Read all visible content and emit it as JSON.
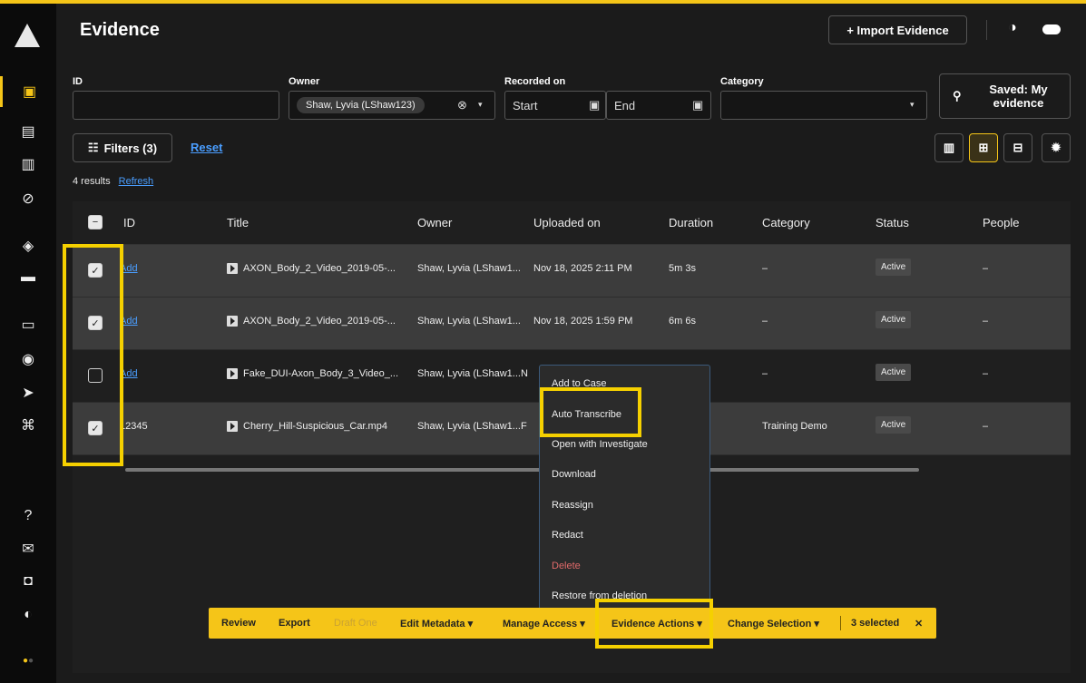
{
  "header": {
    "title": "Evidence",
    "import_label": "+ Import Evidence"
  },
  "filters": {
    "id_label": "ID",
    "owner_label": "Owner",
    "owner_chip": "Shaw, Lyvia (LShaw123)",
    "recorded_label": "Recorded on",
    "start_placeholder": "Start",
    "end_placeholder": "End",
    "category_label": "Category",
    "saved_label": "Saved: My evidence",
    "filters_btn": "Filters (3)",
    "reset": "Reset",
    "results": "4 results",
    "refresh": "Refresh"
  },
  "table": {
    "headers": [
      "ID",
      "Title",
      "Owner",
      "Uploaded on",
      "Duration",
      "Category",
      "Status",
      "People"
    ],
    "rows": [
      {
        "id": "Add",
        "title": "AXON_Body_2_Video_2019-05-...",
        "owner": "Shaw, Lyvia (LShaw1...",
        "uploaded": "Nov 18, 2025 2:11 PM",
        "duration": "5m 3s",
        "category": "–",
        "status": "Active",
        "people": "–",
        "checked": true
      },
      {
        "id": "Add",
        "title": "AXON_Body_2_Video_2019-05-...",
        "owner": "Shaw, Lyvia (LShaw1...",
        "uploaded": "Nov 18, 2025 1:59 PM",
        "duration": "6m 6s",
        "category": "–",
        "status": "Active",
        "people": "–",
        "checked": true
      },
      {
        "id": "Add",
        "title": "Fake_DUI-Axon_Body_3_Video_...",
        "owner": "Shaw, Lyvia (LShaw1...",
        "uploaded": "N",
        "duration": "",
        "category": "–",
        "status": "Active",
        "people": "–",
        "checked": false
      },
      {
        "id": "12345",
        "title": "Cherry_Hill-Suspicious_Car.mp4",
        "owner": "Shaw, Lyvia (LShaw1...",
        "uploaded": "F",
        "duration": "",
        "category": "Training Demo",
        "status": "Active",
        "people": "–",
        "checked": true
      }
    ]
  },
  "menu": {
    "items": [
      "Add to Case",
      "Auto Transcribe",
      "Open with Investigate",
      "Download",
      "Reassign",
      "Redact",
      "Delete",
      "Restore from deletion"
    ],
    "delete_color": "#e06a6a"
  },
  "action_bar": {
    "review": "Review",
    "export": "Export",
    "draft_one": "Draft One",
    "edit_metadata": "Edit Metadata ▾",
    "manage_access": "Manage Access ▾",
    "evidence_actions": "Evidence Actions ▾",
    "change_selection": "Change Selection ▾",
    "selected": "3 selected",
    "close": "✕"
  },
  "colors": {
    "accent": "#f5c518",
    "highlight": "#f5d000"
  }
}
